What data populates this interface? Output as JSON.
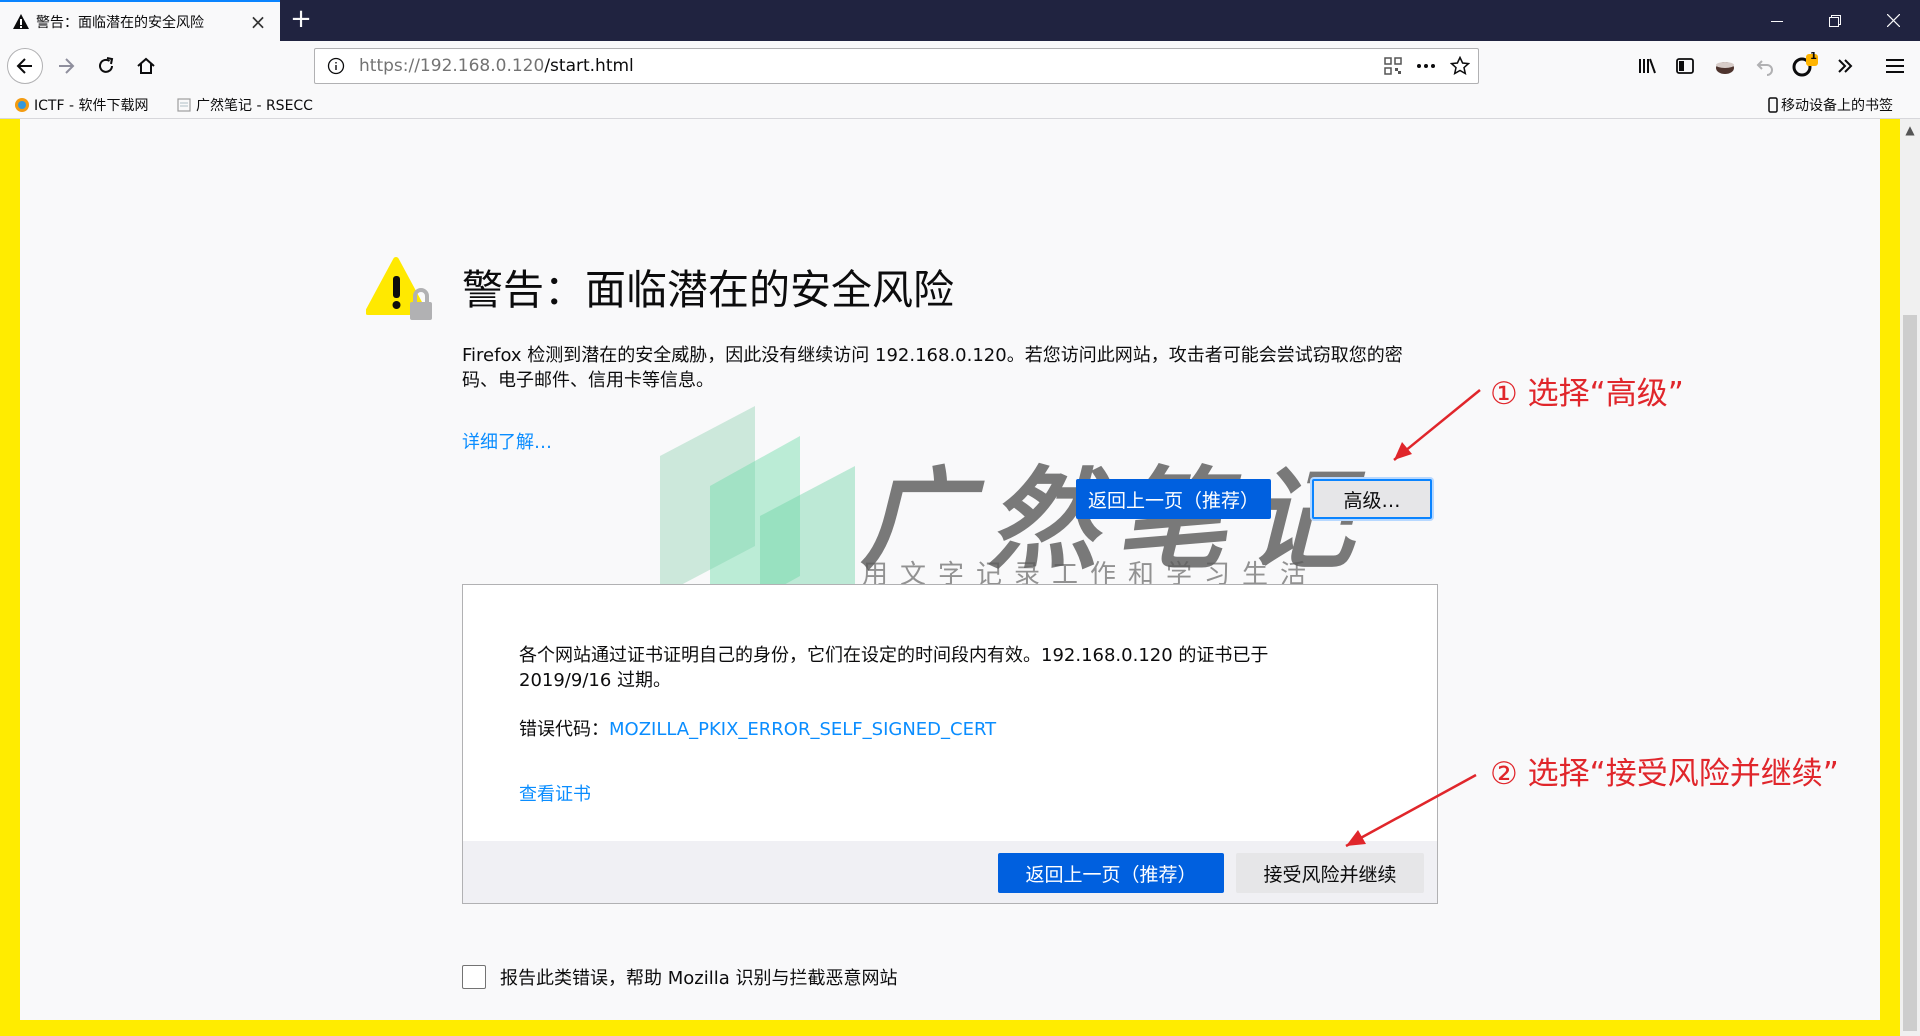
{
  "browser": {
    "tab_title": "警告：面临潜在的安全风险",
    "new_tab": "+",
    "url_host": "https://192.168.0.120",
    "url_path": "/start.html",
    "notification_count": "1"
  },
  "bookmarks": [
    {
      "label": "ICTF - 软件下载网"
    },
    {
      "label": "广然笔记 - RSECC"
    }
  ],
  "mobile_bookmarks": "移动设备上的书签",
  "page": {
    "title": "警告：面临潜在的安全风险",
    "description": "Firefox 检测到潜在的安全威胁，因此没有继续访问 192.168.0.120。若您访问此网站，攻击者可能会尝试窃取您的密码、电子邮件、信用卡等信息。",
    "learn_more": "详细了解…",
    "go_back": "返回上一页（推荐）",
    "advanced": "高级…",
    "advanced_text": "各个网站通过证书证明自己的身份，它们在设定的时间段内有效。192.168.0.120 的证书已于 2019/9/16 过期。",
    "error_code_label": "错误代码：",
    "error_code": "MOZILLA_PKIX_ERROR_SELF_SIGNED_CERT",
    "view_certificate": "查看证书",
    "go_back_2": "返回上一页（推荐）",
    "accept_risk": "接受风险并继续",
    "report_label": "报告此类错误，帮助 Mozilla 识别与拦截恶意网站"
  },
  "annotations": {
    "step1": "① 选择“高级”",
    "step2": "② 选择“接受风险并继续”"
  },
  "watermark": {
    "title": "广然笔记",
    "slogan": "用文字记录工作和学习生活"
  },
  "colors": {
    "primary_button": "#0060df",
    "link": "#0a8dff",
    "annotation": "#e0262b",
    "frame": "#ffec00",
    "titlebar": "#202340"
  }
}
